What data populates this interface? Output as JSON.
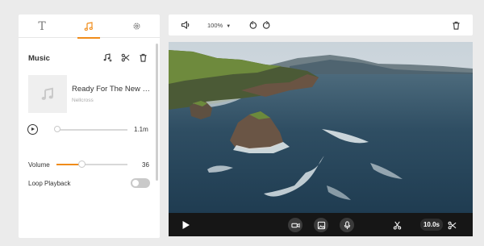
{
  "left_panel": {
    "tabs": [
      {
        "icon": "text-icon",
        "label": "T"
      },
      {
        "icon": "music-note-icon"
      },
      {
        "icon": "gear-icon"
      }
    ],
    "active_tab": 1,
    "music": {
      "title": "Music",
      "track_title": "Ready For The New Day",
      "track_artist": "Nellcross",
      "duration": "1.1m",
      "seek_fraction": 0.0
    },
    "volume": {
      "label": "Volume",
      "value": "36",
      "fraction": 0.36
    },
    "loop": {
      "label": "Loop Playback",
      "enabled": false
    }
  },
  "toolbar": {
    "zoom": "100%"
  },
  "player": {
    "duration_label": "10.0s"
  },
  "colors": {
    "accent": "#f08c1a",
    "dark_bar": "#161616"
  }
}
